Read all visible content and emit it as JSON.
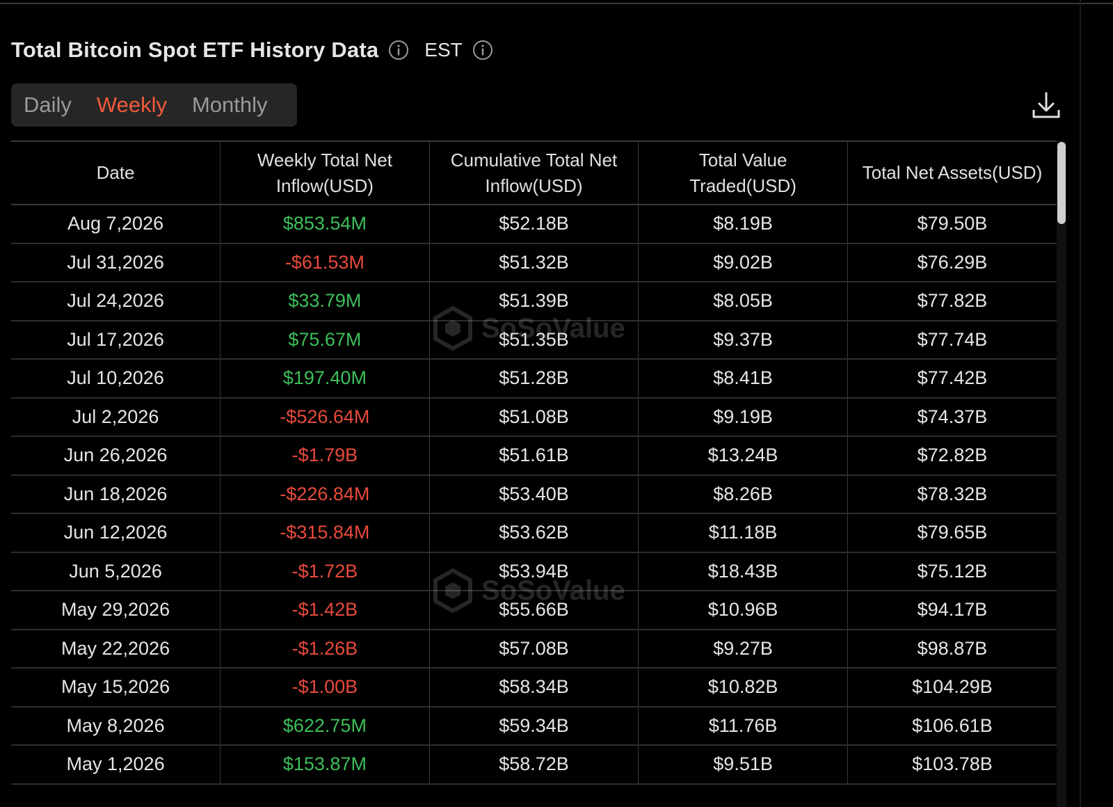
{
  "header": {
    "title": "Total Bitcoin Spot ETF History Data",
    "timezone": "EST"
  },
  "tabs": [
    {
      "label": "Daily",
      "active": false
    },
    {
      "label": "Weekly",
      "active": true
    },
    {
      "label": "Monthly",
      "active": false
    }
  ],
  "watermark": "SoSoValue",
  "colors": {
    "accent": "#f25a3a",
    "positive": "#3dbf5a",
    "negative": "#e84a3c"
  },
  "table": {
    "columns": [
      "Date",
      "Weekly Total Net Inflow(USD)",
      "Cumulative Total Net Inflow(USD)",
      "Total Value Traded(USD)",
      "Total Net Assets(USD)"
    ],
    "rows": [
      [
        "Aug 7,2026",
        "$853.54M",
        "$52.18B",
        "$8.19B",
        "$79.50B"
      ],
      [
        "Jul 31,2026",
        "-$61.53M",
        "$51.32B",
        "$9.02B",
        "$76.29B"
      ],
      [
        "Jul 24,2026",
        "$33.79M",
        "$51.39B",
        "$8.05B",
        "$77.82B"
      ],
      [
        "Jul 17,2026",
        "$75.67M",
        "$51.35B",
        "$9.37B",
        "$77.74B"
      ],
      [
        "Jul 10,2026",
        "$197.40M",
        "$51.28B",
        "$8.41B",
        "$77.42B"
      ],
      [
        "Jul 2,2026",
        "-$526.64M",
        "$51.08B",
        "$9.19B",
        "$74.37B"
      ],
      [
        "Jun 26,2026",
        "-$1.79B",
        "$51.61B",
        "$13.24B",
        "$72.82B"
      ],
      [
        "Jun 18,2026",
        "-$226.84M",
        "$53.40B",
        "$8.26B",
        "$78.32B"
      ],
      [
        "Jun 12,2026",
        "-$315.84M",
        "$53.62B",
        "$11.18B",
        "$79.65B"
      ],
      [
        "Jun 5,2026",
        "-$1.72B",
        "$53.94B",
        "$18.43B",
        "$75.12B"
      ],
      [
        "May 29,2026",
        "-$1.42B",
        "$55.66B",
        "$10.96B",
        "$94.17B"
      ],
      [
        "May 22,2026",
        "-$1.26B",
        "$57.08B",
        "$9.27B",
        "$98.87B"
      ],
      [
        "May 15,2026",
        "-$1.00B",
        "$58.34B",
        "$10.82B",
        "$104.29B"
      ],
      [
        "May 8,2026",
        "$622.75M",
        "$59.34B",
        "$11.76B",
        "$106.61B"
      ],
      [
        "May 1,2026",
        "$153.87M",
        "$58.72B",
        "$9.51B",
        "$103.78B"
      ]
    ]
  }
}
